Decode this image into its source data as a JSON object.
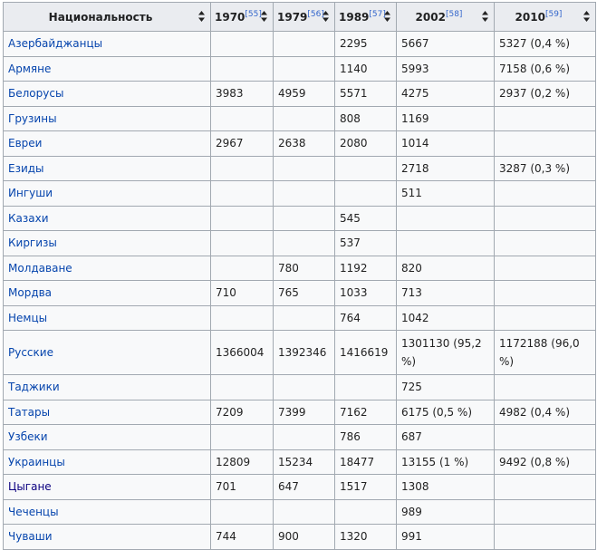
{
  "table": {
    "headers": [
      {
        "label": "Национальность",
        "ref": ""
      },
      {
        "label": "1970",
        "ref": "[55]"
      },
      {
        "label": "1979",
        "ref": "[56]"
      },
      {
        "label": "1989",
        "ref": "[57]"
      },
      {
        "label": "2002",
        "ref": "[58]"
      },
      {
        "label": "2010",
        "ref": "[59]"
      }
    ],
    "rows": [
      {
        "nationality": "Азербайджанцы",
        "y1970": "",
        "y1979": "",
        "y1989": "2295",
        "y2002": "5667",
        "y2010": "5327 (0,4 %)"
      },
      {
        "nationality": "Армяне",
        "y1970": "",
        "y1979": "",
        "y1989": "1140",
        "y2002": "5993",
        "y2010": "7158 (0,6 %)"
      },
      {
        "nationality": "Белорусы",
        "y1970": "3983",
        "y1979": "4959",
        "y1989": "5571",
        "y2002": "4275",
        "y2010": "2937 (0,2 %)"
      },
      {
        "nationality": "Грузины",
        "y1970": "",
        "y1979": "",
        "y1989": "808",
        "y2002": "1169",
        "y2010": ""
      },
      {
        "nationality": "Евреи",
        "y1970": "2967",
        "y1979": "2638",
        "y1989": "2080",
        "y2002": "1014",
        "y2010": ""
      },
      {
        "nationality": "Езиды",
        "y1970": "",
        "y1979": "",
        "y1989": "",
        "y2002": "2718",
        "y2010": "3287 (0,3 %)"
      },
      {
        "nationality": "Ингуши",
        "y1970": "",
        "y1979": "",
        "y1989": "",
        "y2002": "511",
        "y2010": ""
      },
      {
        "nationality": "Казахи",
        "y1970": "",
        "y1979": "",
        "y1989": "545",
        "y2002": "",
        "y2010": ""
      },
      {
        "nationality": "Киргизы",
        "y1970": "",
        "y1979": "",
        "y1989": "537",
        "y2002": "",
        "y2010": ""
      },
      {
        "nationality": "Молдаване",
        "y1970": "",
        "y1979": "780",
        "y1989": "1192",
        "y2002": "820",
        "y2010": ""
      },
      {
        "nationality": "Мордва",
        "y1970": "710",
        "y1979": "765",
        "y1989": "1033",
        "y2002": "713",
        "y2010": ""
      },
      {
        "nationality": "Немцы",
        "y1970": "",
        "y1979": "",
        "y1989": "764",
        "y2002": "1042",
        "y2010": ""
      },
      {
        "nationality": "Русские",
        "y1970": "1366004",
        "y1979": "1392346",
        "y1989": "1416619",
        "y2002": "1301130 (95,2 %)",
        "y2010": "1172188 (96,0 %)"
      },
      {
        "nationality": "Таджики",
        "y1970": "",
        "y1979": "",
        "y1989": "",
        "y2002": "725",
        "y2010": ""
      },
      {
        "nationality": "Татары",
        "y1970": "7209",
        "y1979": "7399",
        "y1989": "7162",
        "y2002": "6175 (0,5 %)",
        "y2010": "4982 (0,4 %)"
      },
      {
        "nationality": "Узбеки",
        "y1970": "",
        "y1979": "",
        "y1989": "786",
        "y2002": "687",
        "y2010": ""
      },
      {
        "nationality": "Украинцы",
        "y1970": "12809",
        "y1979": "15234",
        "y1989": "18477",
        "y2002": "13155 (1 %)",
        "y2010": "9492 (0,8 %)"
      },
      {
        "nationality": "Цыгане",
        "y1970": "701",
        "y1979": "647",
        "y1989": "1517",
        "y2002": "1308",
        "y2010": ""
      },
      {
        "nationality": "Чеченцы",
        "y1970": "",
        "y1979": "",
        "y1989": "",
        "y2002": "989",
        "y2010": ""
      },
      {
        "nationality": "Чуваши",
        "y1970": "744",
        "y1979": "900",
        "y1989": "1320",
        "y2002": "991",
        "y2010": ""
      }
    ]
  }
}
